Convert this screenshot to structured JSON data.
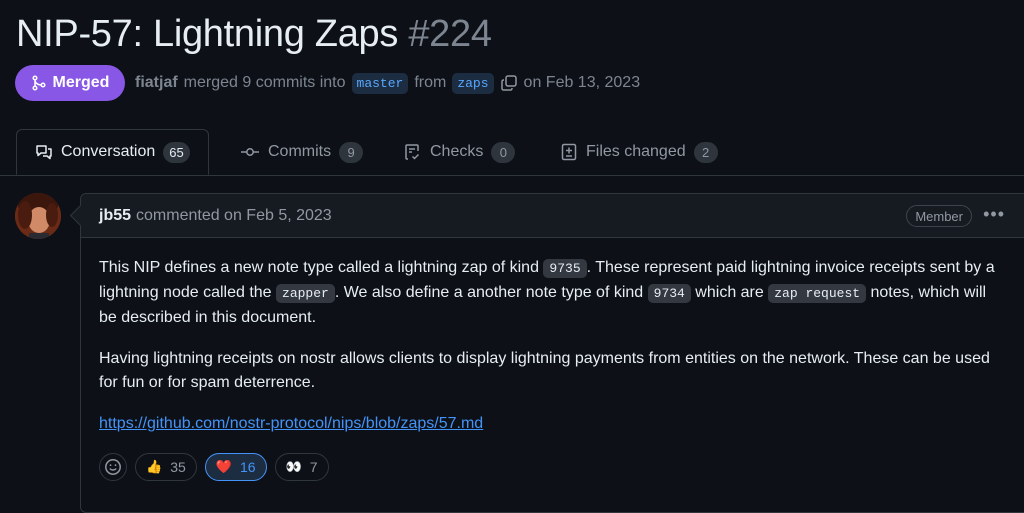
{
  "pr": {
    "title": "NIP-57: Lightning Zaps",
    "number": "#224",
    "state": "Merged",
    "author": "fiatjaf",
    "merged_text": "merged 9 commits into",
    "base_branch": "master",
    "from_text": "from",
    "head_branch": "zaps",
    "date_text": "on Feb 13, 2023"
  },
  "tabs": [
    {
      "label": "Conversation",
      "count": "65"
    },
    {
      "label": "Commits",
      "count": "9"
    },
    {
      "label": "Checks",
      "count": "0"
    },
    {
      "label": "Files changed",
      "count": "2"
    }
  ],
  "comment": {
    "author": "jb55",
    "action": "commented on Feb 5, 2023",
    "role": "Member",
    "p1_a": "This NIP defines a new note type called a lightning zap of kind ",
    "p1_code1": "9735",
    "p1_b": ". These represent paid lightning invoice receipts sent by a lightning node called the ",
    "p1_code2": "zapper",
    "p1_c": ". We also define a another note type of kind ",
    "p1_code3": "9734",
    "p1_d": " which are ",
    "p1_code4": "zap request",
    "p1_e": " notes, which will be described in this document.",
    "p2": "Having lightning receipts on nostr allows clients to display lightning payments from entities on the network. These can be used for fun or for spam deterrence.",
    "link": "https://github.com/nostr-protocol/nips/blob/zaps/57.md"
  },
  "reactions": [
    {
      "emoji": "👍",
      "count": "35"
    },
    {
      "emoji": "❤️",
      "count": "16"
    },
    {
      "emoji": "👀",
      "count": "7"
    }
  ],
  "colors": {
    "merged": "#8957e5",
    "link": "#4493f8",
    "background": "#0d1117"
  }
}
